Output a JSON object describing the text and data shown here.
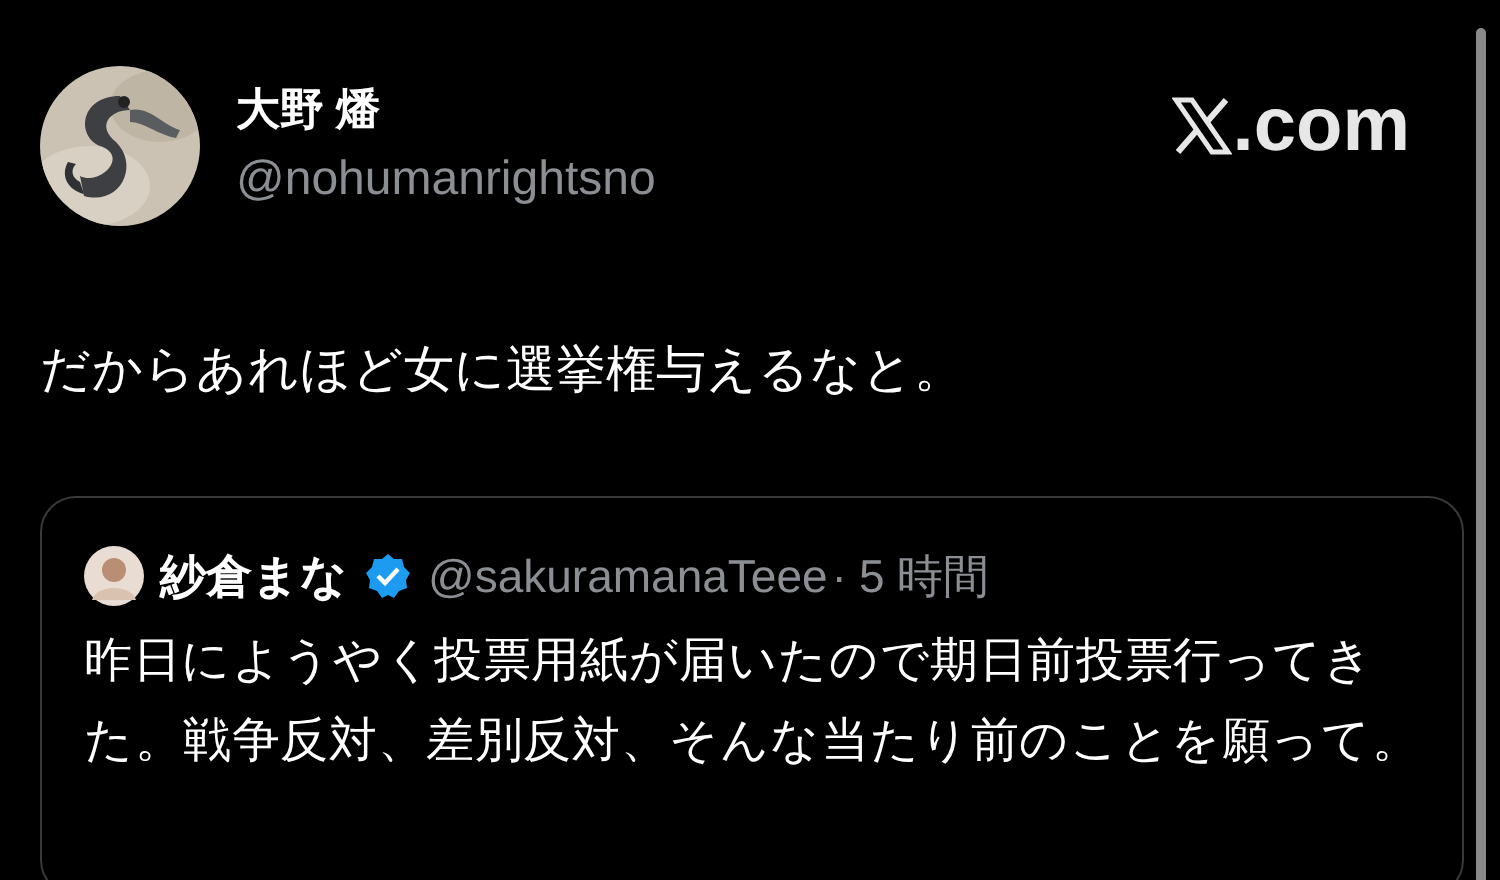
{
  "author": {
    "name": "大野 燔",
    "handle": "@nohumanrightsno"
  },
  "site": {
    "domain": ".com"
  },
  "tweet": {
    "text": "だからあれほど女に選挙権与えるなと。"
  },
  "quote": {
    "name": "紗倉まな",
    "verified": true,
    "handle": "@sakuramanaTeee",
    "separator": "·",
    "time": "5 時間",
    "text": "昨日にようやく投票用紙が届いたので期日前投票行ってきた。戦争反対、差別反対、そんな当たり前のことを願って。"
  }
}
